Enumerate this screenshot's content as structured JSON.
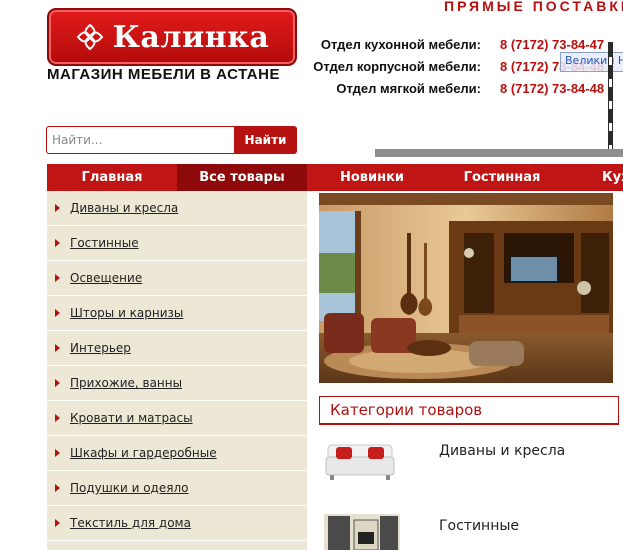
{
  "logo": {
    "text": "Калинка",
    "icon": "flower-ornament-icon"
  },
  "tagline": "МАГАЗИН МЕБЕЛИ В АСТАНЕ",
  "direct_supplies": "ПРЯМЫЕ ПОСТАВКИ",
  "contacts": [
    {
      "label": "Отдел кухонной мебели:",
      "phone": "8 (7172) 73-84-47"
    },
    {
      "label": "Отдел корпусной мебели:",
      "phone": "8 (7172) 73-84-48"
    },
    {
      "label": "Отдел мягкой мебели:",
      "phone": "8 (7172) 73-84-48"
    }
  ],
  "tooltip": "Великий Н",
  "search": {
    "placeholder": "Найти...",
    "button": "Найти"
  },
  "nav": [
    {
      "label": "Главная",
      "active": false
    },
    {
      "label": "Все товары",
      "active": true
    },
    {
      "label": "Новинки",
      "active": false
    },
    {
      "label": "Гостинная",
      "active": false
    },
    {
      "label": "Кухни",
      "active": false
    }
  ],
  "sidebar": [
    "Диваны и кресла",
    "Гостинные",
    "Освещение",
    "Шторы и карнизы",
    "Интерьер",
    "Прихожие, ванны",
    "Кровати и матрасы",
    "Шкафы и гардеробные",
    "Подушки и одеяло",
    "Текстиль для дома"
  ],
  "categories": {
    "title": "Категории товаров",
    "items": [
      {
        "label": "Диваны и кресла",
        "thumb": "sofa-thumbnail"
      },
      {
        "label": "Гостинные",
        "thumb": "living-room-thumbnail"
      }
    ]
  },
  "colors": {
    "brand_red": "#bf1515",
    "active_nav": "#8e0a0a",
    "sidebar_bg": "#ede8d5"
  }
}
